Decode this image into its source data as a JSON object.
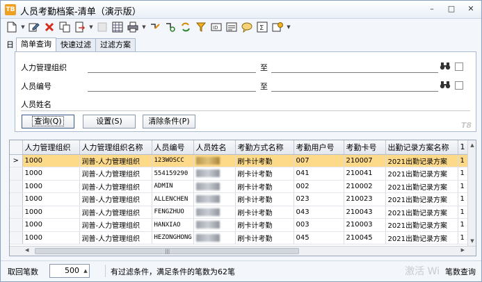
{
  "window": {
    "app_icon": "TB",
    "title": "人员考勤档案-清单（演示版）",
    "minimize": "–",
    "maximize": "□",
    "close": "✕"
  },
  "toolbar": {
    "icons": [
      "new-doc-icon",
      "edit-icon",
      "delete-icon",
      "copy-icon",
      "export-icon",
      "disabled-icon",
      "grid-icon",
      "print-icon",
      "refresh-link-icon",
      "locate-icon",
      "sync-icon",
      "filter-icon",
      "id-icon",
      "list-icon",
      "comment-icon",
      "sum-icon",
      "approve-icon"
    ]
  },
  "panel": {
    "marker": "日",
    "tabs": [
      "简单查询",
      "快速过滤",
      "过滤方案"
    ],
    "active_tab": 0,
    "fields": [
      {
        "label": "人力管理组织",
        "to": "至"
      },
      {
        "label": "人员编号",
        "to": "至"
      },
      {
        "label": "人员姓名"
      }
    ],
    "buttons": {
      "query": "查询(Q)",
      "settings": "设置(S)",
      "clear": "清除条件(P)"
    },
    "brand": "T8"
  },
  "grid": {
    "columns": [
      "人力管理组织",
      "人力管理组织名称",
      "人员编号",
      "人员姓名",
      "考勤方式名称",
      "考勤用户号",
      "考勤卡号",
      "出勤记录方案名称",
      "1"
    ],
    "rows": [
      {
        "org": "1000",
        "org_name": "润普-人力管理组织",
        "emp_no": "123WOSCC",
        "att_mode": "刷卡计考勤",
        "user_no": "007",
        "card_no": "210007",
        "scheme": "2021出勤记录方案",
        "extra": "1",
        "selected": true
      },
      {
        "org": "1000",
        "org_name": "润普-人力管理组织",
        "emp_no": "554159290",
        "att_mode": "刷卡计考勤",
        "user_no": "041",
        "card_no": "210041",
        "scheme": "2021出勤记录方案",
        "extra": "1",
        "selected": false
      },
      {
        "org": "1000",
        "org_name": "润普-人力管理组织",
        "emp_no": "ADMIN",
        "att_mode": "刷卡计考勤",
        "user_no": "002",
        "card_no": "210002",
        "scheme": "2021出勤记录方案",
        "extra": "1",
        "selected": false
      },
      {
        "org": "1000",
        "org_name": "润普-人力管理组织",
        "emp_no": "ALLENCHEN",
        "att_mode": "刷卡计考勤",
        "user_no": "023",
        "card_no": "210023",
        "scheme": "2021出勤记录方案",
        "extra": "1",
        "selected": false
      },
      {
        "org": "1000",
        "org_name": "润普-人力管理组织",
        "emp_no": "FENGZHUO",
        "att_mode": "刷卡计考勤",
        "user_no": "043",
        "card_no": "210043",
        "scheme": "2021出勤记录方案",
        "extra": "1",
        "selected": false
      },
      {
        "org": "1000",
        "org_name": "润普-人力管理组织",
        "emp_no": "HANXIAO",
        "att_mode": "刷卡计考勤",
        "user_no": "003",
        "card_no": "210003",
        "scheme": "2021出勤记录方案",
        "extra": "1",
        "selected": false
      },
      {
        "org": "1000",
        "org_name": "润普-人力管理组织",
        "emp_no": "HEZONGHONG",
        "att_mode": "刷卡计考勤",
        "user_no": "045",
        "card_no": "210045",
        "scheme": "2021出勤记录方案",
        "extra": "1",
        "selected": false
      }
    ],
    "row_indicator": ">"
  },
  "status": {
    "fetch_label": "取回笔数",
    "fetch_value": "500",
    "message": "有过滤条件，满足条件的笔数为62笔",
    "right_label": "笔数查询",
    "watermark": "激活 Wi"
  }
}
